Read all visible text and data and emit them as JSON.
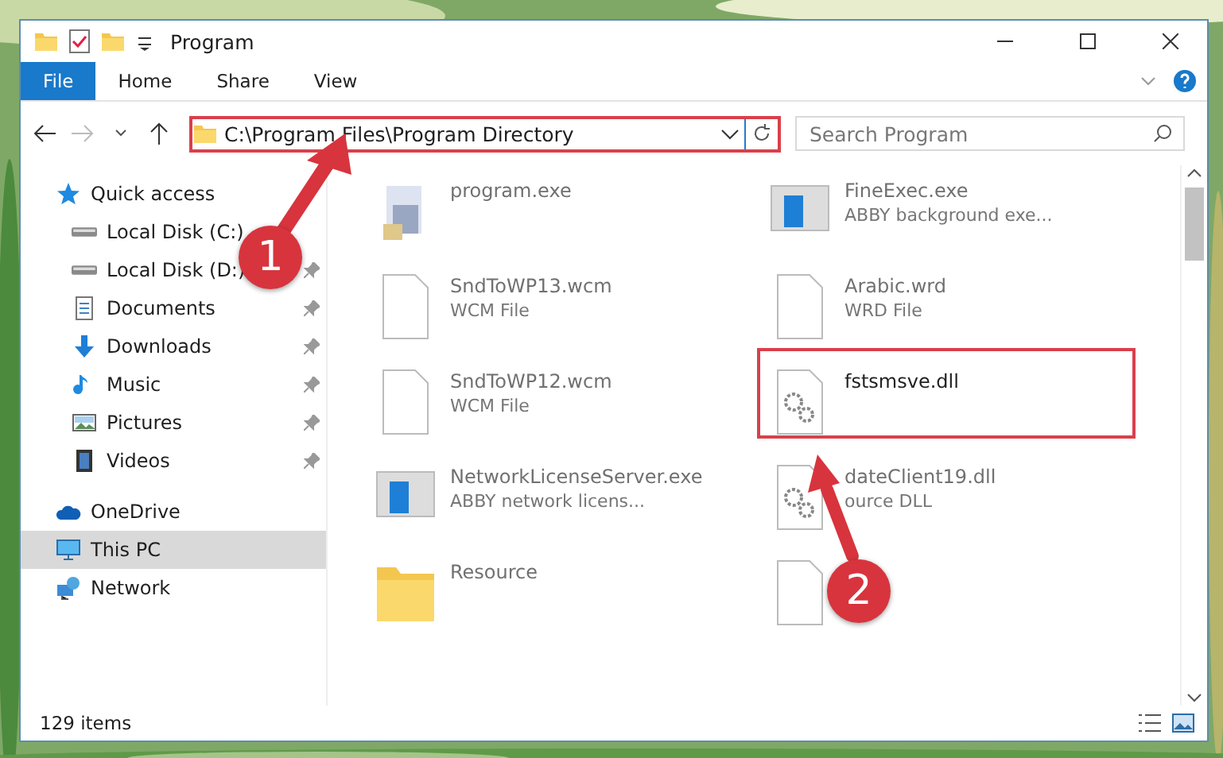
{
  "window": {
    "title": "Program"
  },
  "ribbon_tabs": [
    {
      "label": "File",
      "kind": "file"
    },
    {
      "label": "Home",
      "kind": "tab"
    },
    {
      "label": "Share",
      "kind": "tab"
    },
    {
      "label": "View",
      "kind": "tab"
    }
  ],
  "address_bar": {
    "path": "C:\\Program Files\\Program Directory",
    "annotated": true
  },
  "search": {
    "placeholder": "Search Program"
  },
  "sidebar": {
    "items": [
      {
        "label": "Quick access",
        "kind": "star",
        "selected": false,
        "children": [
          {
            "label": "Local Disk (C:)",
            "kind": "drive",
            "pinned": false
          },
          {
            "label": "Local Disk (D:)",
            "kind": "drive",
            "pinned": true
          },
          {
            "label": "Documents",
            "kind": "document",
            "pinned": true
          },
          {
            "label": "Downloads",
            "kind": "download",
            "pinned": true
          },
          {
            "label": "Music",
            "kind": "music",
            "pinned": true
          },
          {
            "label": "Pictures",
            "kind": "pictures",
            "pinned": true
          },
          {
            "label": "Videos",
            "kind": "videos",
            "pinned": true
          }
        ]
      },
      {
        "label": "OneDrive",
        "kind": "cloud",
        "selected": false
      },
      {
        "label": "This PC",
        "kind": "pc",
        "selected": true
      },
      {
        "label": "Network",
        "kind": "network",
        "selected": false
      }
    ]
  },
  "files": [
    {
      "name": "program.exe",
      "kind": "installer",
      "annotated": false
    },
    {
      "name": "FineExec.exe",
      "type": "ABBY background exe...",
      "kind": "app",
      "annotated": false
    },
    {
      "name": "SndToWP13.wcm",
      "type": "WCM File",
      "kind": "file",
      "annotated": false
    },
    {
      "name": "Arabic.wrd",
      "type": "WRD File",
      "kind": "file",
      "annotated": false
    },
    {
      "name": "SndToWP12.wcm",
      "type": "WCM File",
      "kind": "file",
      "annotated": false
    },
    {
      "name": "fstsmsve.dll",
      "kind": "dll",
      "annotated": true
    },
    {
      "name": "NetworkLicenseServer.exe",
      "type": "ABBY network licens...",
      "kind": "app",
      "annotated": false
    },
    {
      "name": "dateClient19.dll",
      "type": "ource DLL",
      "kind": "dll",
      "annotated": false
    },
    {
      "name": "Resource",
      "kind": "folder",
      "annotated": false
    },
    {
      "kind": "file",
      "annotated": false
    }
  ],
  "annotations": [
    {
      "number": "1"
    },
    {
      "number": "2"
    }
  ],
  "status_bar": {
    "count": "129 items"
  }
}
